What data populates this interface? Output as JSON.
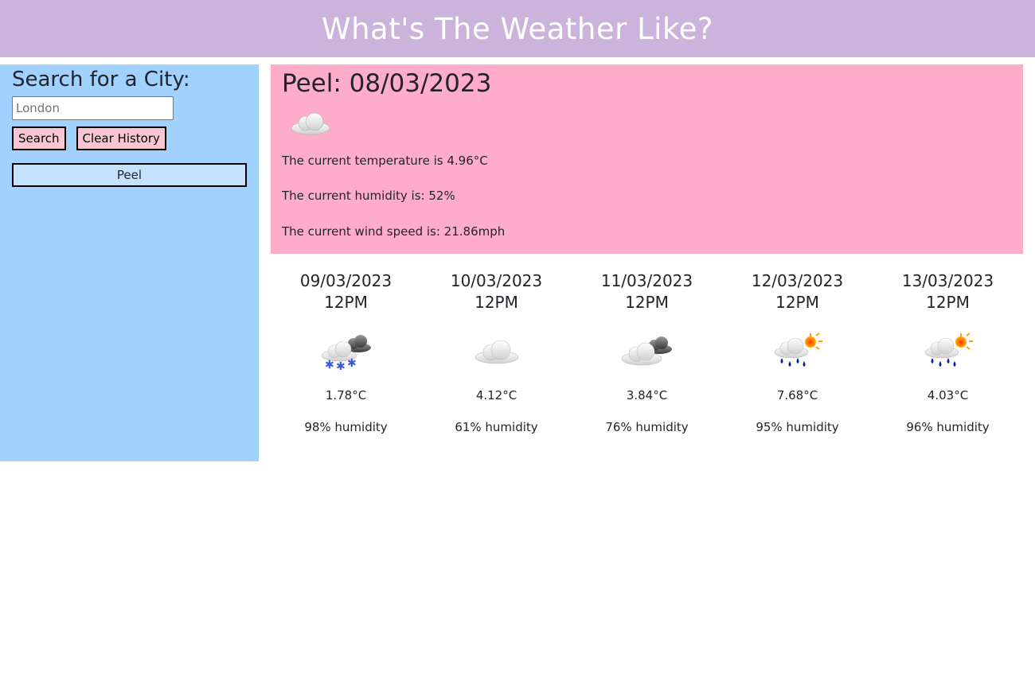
{
  "header": {
    "title": "What's The Weather Like?"
  },
  "sidebar": {
    "heading": "Search for a City:",
    "search_placeholder": "London",
    "search_button": "Search",
    "clear_button": "Clear History",
    "history": [
      "Peel"
    ]
  },
  "current": {
    "title": "Peel: 08/03/2023",
    "icon": "cloud-icon",
    "temperature_text": "The current temperature is 4.96°C",
    "humidity_text": "The current humidity is: 52%",
    "wind_text": "The current wind speed is: 21.86mph"
  },
  "forecast": [
    {
      "date": "09/03/2023",
      "time": "12PM",
      "icon": "snow-cloud-icon",
      "temp": "1.78°C",
      "humidity": "98% humidity"
    },
    {
      "date": "10/03/2023",
      "time": "12PM",
      "icon": "cloud-icon",
      "temp": "4.12°C",
      "humidity": "61% humidity"
    },
    {
      "date": "11/03/2023",
      "time": "12PM",
      "icon": "broken-clouds-icon",
      "temp": "3.84°C",
      "humidity": "76% humidity"
    },
    {
      "date": "12/03/2023",
      "time": "12PM",
      "icon": "rain-sun-icon",
      "temp": "7.68°C",
      "humidity": "95% humidity"
    },
    {
      "date": "13/03/2023",
      "time": "12PM",
      "icon": "rain-sun-icon",
      "temp": "4.03°C",
      "humidity": "96% humidity"
    }
  ],
  "colors": {
    "header_bg": "#ccb3db",
    "sidebar_bg": "#a0d1ff",
    "current_bg": "#ffaccb",
    "button_bg": "#fbc6d4",
    "history_button_bg": "#c4e2fd"
  }
}
